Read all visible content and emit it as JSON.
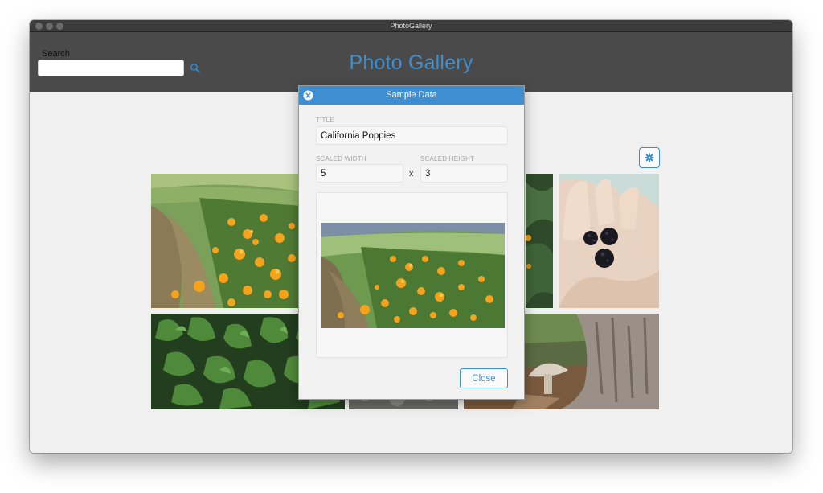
{
  "window": {
    "title": "PhotoGallery"
  },
  "header": {
    "search_label": "Search",
    "search_value": "",
    "search_placeholder": "",
    "title": "Photo Gallery"
  },
  "gallery": {
    "photos": [
      {
        "subject": "california-poppies"
      },
      {
        "subject": "foliage"
      },
      {
        "subject": "blackberries-in-hand"
      },
      {
        "subject": "parsley-leaves"
      },
      {
        "subject": "stones"
      },
      {
        "subject": "mushroom-tree-trunk"
      }
    ]
  },
  "modal": {
    "header_title": "Sample Data",
    "title_label": "TITLE",
    "title_value": "California Poppies",
    "scaled_width_label": "SCALED WIDTH",
    "scaled_width_value": "5",
    "times_symbol": "x",
    "scaled_height_label": "SCALED HEIGHT",
    "scaled_height_value": "3",
    "close_label": "Close"
  },
  "colors": {
    "accent": "#3d8fd1",
    "header_bg": "#4a4a4a",
    "content_bg": "#f0f0f0"
  },
  "icons": [
    "search-icon",
    "gear-icon",
    "close-circle-icon"
  ]
}
